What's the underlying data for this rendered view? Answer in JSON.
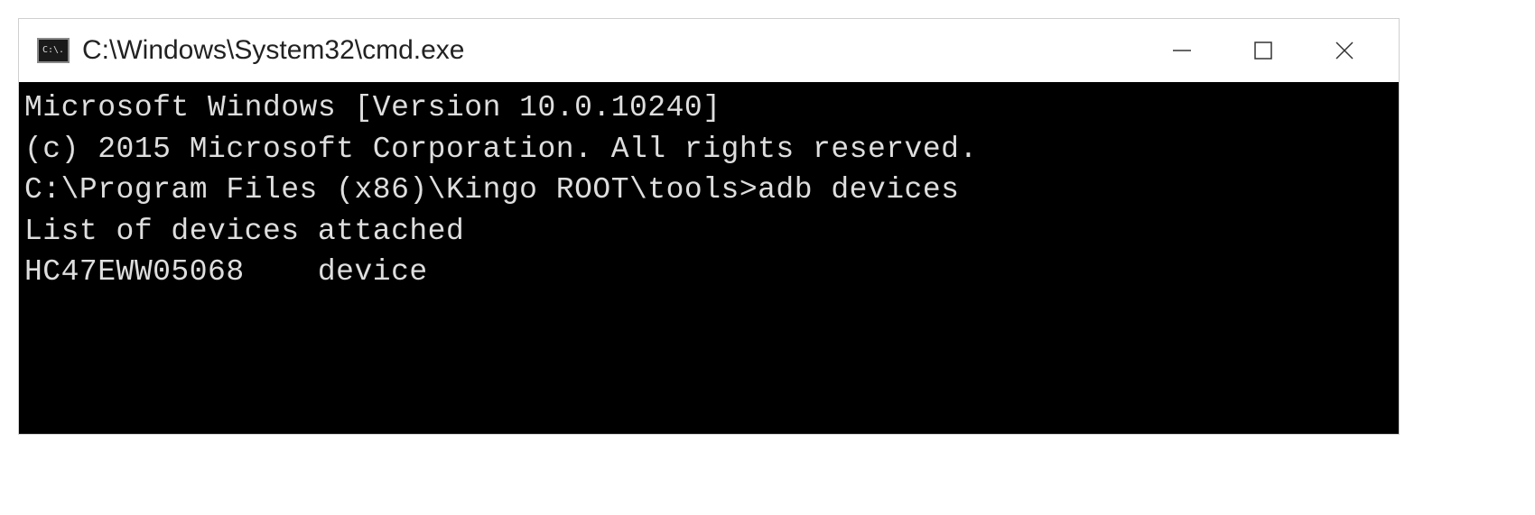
{
  "window": {
    "title": "C:\\Windows\\System32\\cmd.exe",
    "icon_label": "C:\\."
  },
  "terminal": {
    "line1": "Microsoft Windows [Version 10.0.10240]",
    "line2": "(c) 2015 Microsoft Corporation. All rights reserved.",
    "blank1": "",
    "prompt_line": "C:\\Program Files (x86)\\Kingo ROOT\\tools>adb devices",
    "output1": "List of devices attached",
    "output2": "HC47EWW05068    device"
  }
}
